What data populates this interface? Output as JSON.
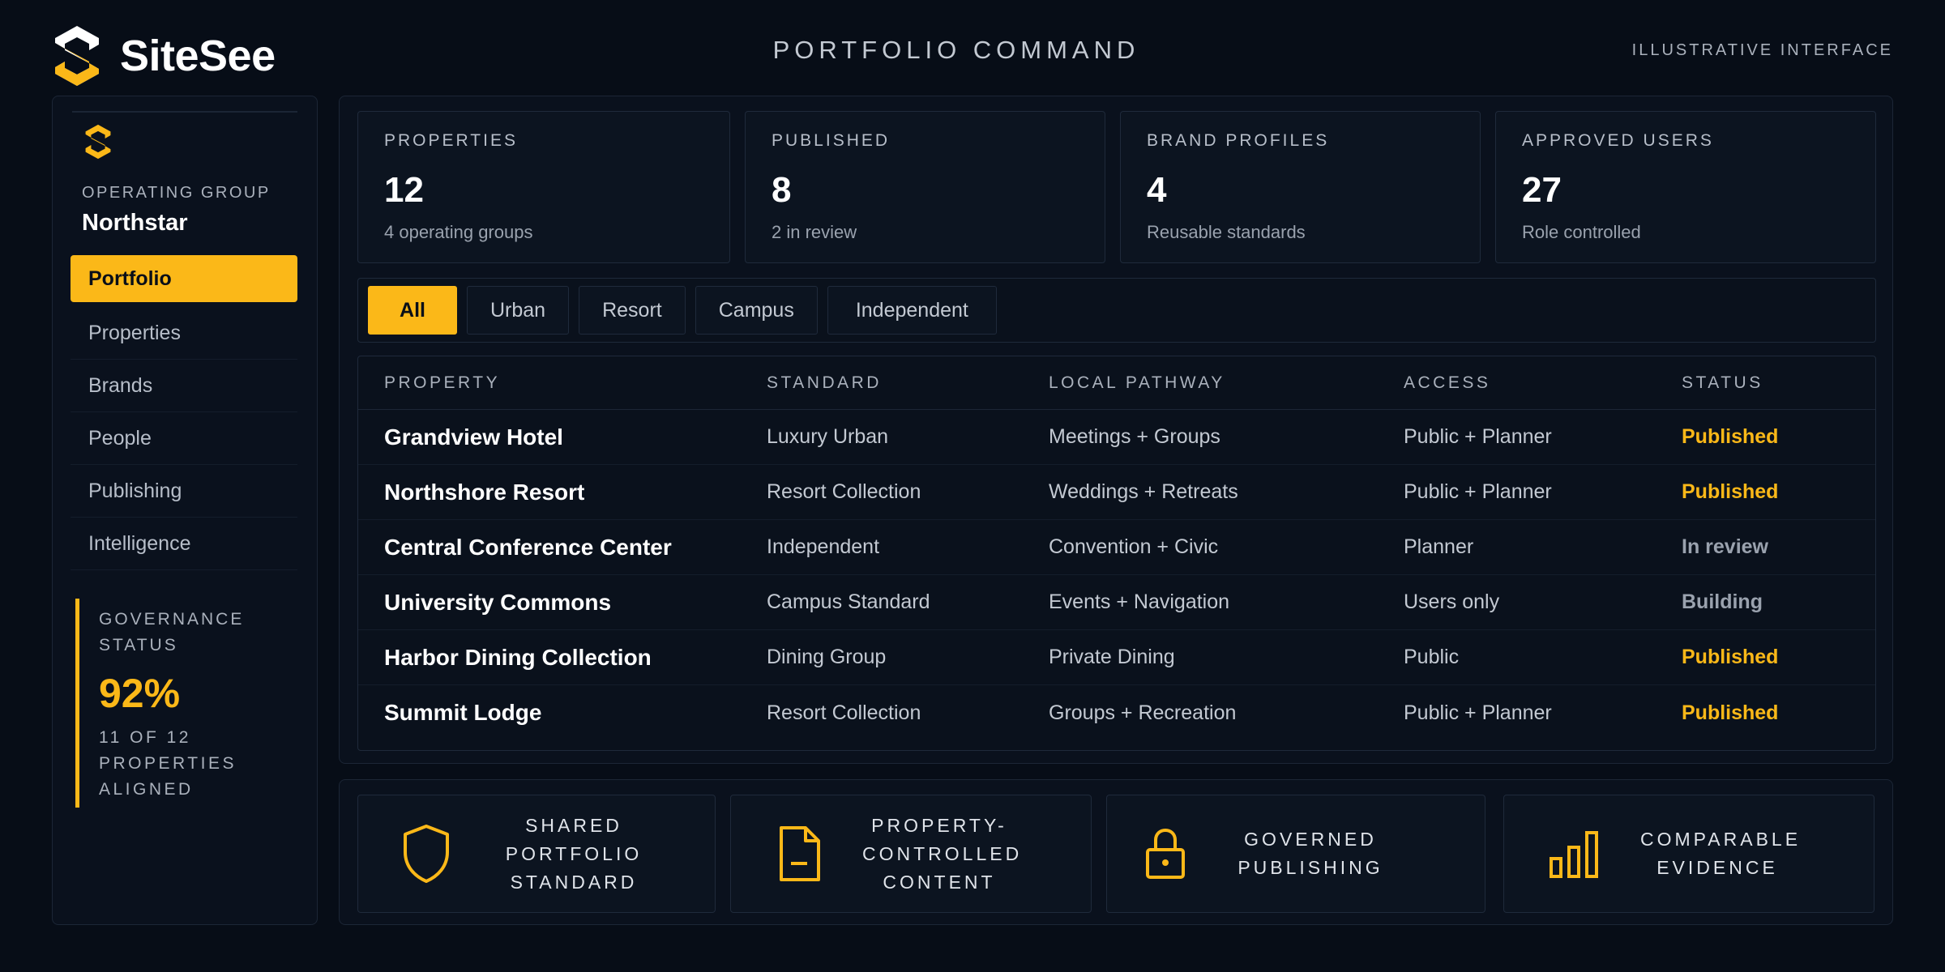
{
  "brand": {
    "name": "SiteSee"
  },
  "header": {
    "title": "PORTFOLIO COMMAND",
    "tag": "ILLUSTRATIVE INTERFACE"
  },
  "sidebar": {
    "group_label": "OPERATING GROUP",
    "group_name": "Northstar",
    "items": [
      {
        "label": "Portfolio",
        "active": true
      },
      {
        "label": "Properties"
      },
      {
        "label": "Brands"
      },
      {
        "label": "People"
      },
      {
        "label": "Publishing"
      },
      {
        "label": "Intelligence"
      }
    ],
    "governance": {
      "label": "GOVERNANCE STATUS",
      "value": "92%",
      "sub": "11 OF 12 PROPERTIES ALIGNED"
    }
  },
  "stats": [
    {
      "label": "PROPERTIES",
      "value": "12",
      "sub": "4 operating groups"
    },
    {
      "label": "PUBLISHED",
      "value": "8",
      "sub": "2 in review"
    },
    {
      "label": "BRAND PROFILES",
      "value": "4",
      "sub": "Reusable standards"
    },
    {
      "label": "APPROVED USERS",
      "value": "27",
      "sub": "Role controlled"
    }
  ],
  "filters": [
    "All",
    "Urban",
    "Resort",
    "Campus",
    "Independent"
  ],
  "table": {
    "headers": [
      "PROPERTY",
      "STANDARD",
      "LOCAL PATHWAY",
      "ACCESS",
      "STATUS"
    ],
    "rows": [
      [
        "Grandview Hotel",
        "Luxury Urban",
        "Meetings + Groups",
        "Public + Planner",
        "Published"
      ],
      [
        "Northshore Resort",
        "Resort Collection",
        "Weddings + Retreats",
        "Public + Planner",
        "Published"
      ],
      [
        "Central Conference Center",
        "Independent",
        "Convention + Civic",
        "Planner",
        "In review"
      ],
      [
        "University Commons",
        "Campus Standard",
        "Events + Navigation",
        "Users only",
        "Building"
      ],
      [
        "Harbor Dining Collection",
        "Dining Group",
        "Private Dining",
        "Public",
        "Published"
      ],
      [
        "Summit Lodge",
        "Resort Collection",
        "Groups + Recreation",
        "Public + Planner",
        "Published"
      ]
    ]
  },
  "features": [
    {
      "icon": "shield-icon",
      "lines": [
        "SHARED",
        "PORTFOLIO",
        "STANDARD"
      ]
    },
    {
      "icon": "document-icon",
      "lines": [
        "PROPERTY-",
        "CONTROLLED",
        "CONTENT"
      ]
    },
    {
      "icon": "lock-icon",
      "lines": [
        "GOVERNED",
        "PUBLISHING"
      ]
    },
    {
      "icon": "bar-chart-icon",
      "lines": [
        "COMPARABLE",
        "EVIDENCE"
      ]
    }
  ],
  "colors": {
    "accent": "#fbb818",
    "background": "#070d17",
    "panel": "#0a111d",
    "muted_status": "#9aa2ae"
  }
}
